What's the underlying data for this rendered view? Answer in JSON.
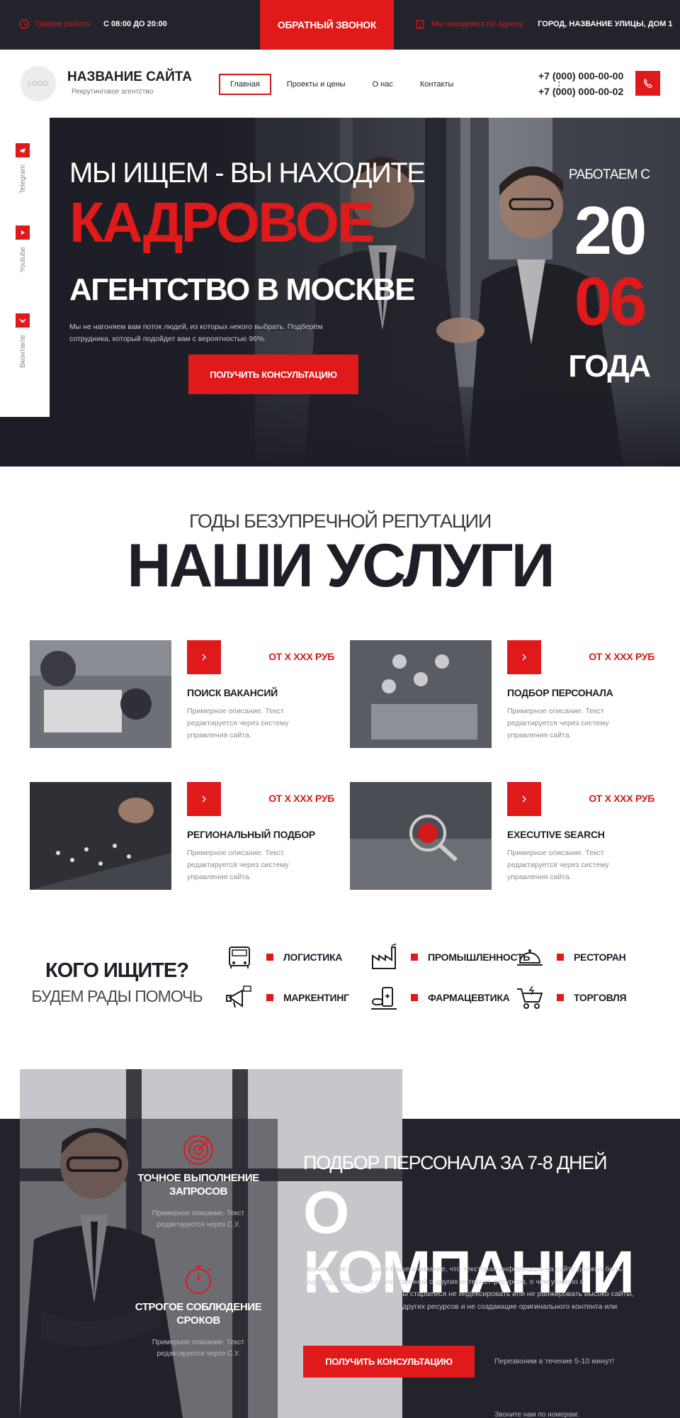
{
  "topbar": {
    "schedule_label": "График работы",
    "schedule_value": "С 08:00 ДО 20:00",
    "callback_label": "ОБРАТНЫЙ ЗВОНОК",
    "address_label": "Мы находимся по адресу:",
    "address_value": "ГОРОД, НАЗВАНИЕ УЛИЦЫ, ДОМ 1",
    "accent": "#e0191b",
    "background": "#22232b"
  },
  "header": {
    "logo_text": "LOGO",
    "site_name": "НАЗВАНИЕ САЙТА",
    "site_sub": "Рекрутинговое агентство",
    "nav": [
      {
        "label": "Главная",
        "active": true
      },
      {
        "label": "Проекты и цены"
      },
      {
        "label": "О нас"
      },
      {
        "label": "Контакты"
      }
    ],
    "more": "⋮",
    "phones": [
      "+7 (000) 000-00-00",
      "+7 (000) 000-00-02"
    ]
  },
  "social": [
    {
      "label": "Telegram",
      "icon": "telegram-icon"
    },
    {
      "label": "Youtube",
      "icon": "youtube-icon"
    },
    {
      "label": "Вконтакте",
      "icon": "vk-icon"
    }
  ],
  "hero": {
    "line1": "МЫ ИЩЕМ - ВЫ НАХОДИТЕ",
    "line2": "КАДРОВОЕ",
    "line3": "АГЕНТСТВО В МОСКВЕ",
    "description": "Мы не нагоняем вам поток людей, из которых некого выбрать. Подберём сотрудника, который подойдет вам с вероятностью 96%.",
    "button": "ПОЛУЧИТЬ КОНСУЛЬТАЦИЮ",
    "since_label": "РАБОТАЕМ С",
    "since_a": "20",
    "since_b": "06",
    "since_c": "ГОДА"
  },
  "services": {
    "subtitle": "ГОДЫ БЕЗУПРЕЧНОЙ РЕПУТАЦИИ",
    "title": "НАШИ УСЛУГИ",
    "items": [
      {
        "title": "ПОИСК ВАКАНСИЙ",
        "price": "ОТ Х ХХХ РУБ",
        "description": "Примерное описание. Текст редактируется через систему управления сайта."
      },
      {
        "title": "ПОДБОР ПЕРСОНАЛА",
        "price": "ОТ Х ХХХ РУБ",
        "description": "Примерное описание. Текст редактируется через систему управления сайта."
      },
      {
        "title": "РЕГИОНАЛЬНЫЙ ПОДБОР",
        "price": "ОТ Х ХХХ РУБ",
        "description": "Примерное описание. Текст редактируется через систему управления сайта."
      },
      {
        "title": "EXECUTIVE SEARCH",
        "price": "ОТ Х ХХХ РУБ",
        "description": "Примерное описание. Текст редактируется через систему управления сайта."
      }
    ]
  },
  "who": {
    "title": "КОГО ИЩИТЕ?",
    "subtitle": "БУДЕМ РАДЫ ПОМОЧЬ",
    "industries": [
      {
        "label": "ЛОГИСТИКА",
        "icon": "truck-icon"
      },
      {
        "label": "ПРОМЫШЛЕННОСТЬ",
        "icon": "factory-icon"
      },
      {
        "label": "РЕСТОРАН",
        "icon": "cloche-icon"
      },
      {
        "label": "МАРКЕНТИНГ",
        "icon": "megaphone-icon"
      },
      {
        "label": "ФАРМАЦЕВТИКА",
        "icon": "pharmacy-icon"
      },
      {
        "label": "ТОРГОВЛЯ",
        "icon": "cart-icon"
      }
    ]
  },
  "about": {
    "features": [
      {
        "title": "ТОЧНОЕ ВЫПОЛНЕНИЕ ЗАПРОСОВ",
        "description": "Примерное описание. Текст редактируется через С.У.",
        "icon": "target-icon"
      },
      {
        "title": "СТРОГОЕ СОБЛЮДЕНИЕ СРОКОВ",
        "description": "Примерное описание. Текст редактируется через С.У.",
        "icon": "stopwatch-icon"
      }
    ],
    "subtitle": "ПОДБОР ПЕРСОНАЛА ЗА 7-8 ДНЕЙ",
    "title": "О КОМПАНИИ",
    "note": "Примечание. Обращаем Ваше внимание, что текстовая информация на сайте должна быть индивидуальной, не скопированной с других интернет-ресурсов, о чем указано в рекомендациях Яндекса: «Мы стараемся не индексировать или не ранжировать высоко сайты, копирующие информацию с других ресурсов и не создающие оригинального контента или сервиса».",
    "button": "ПОЛУЧИТЬ КОНСУЛЬТАЦИЮ",
    "callback_note": "Перезвоним в течение 5-10 минут!",
    "bottom_note": "Звоните нам по номерам:"
  }
}
